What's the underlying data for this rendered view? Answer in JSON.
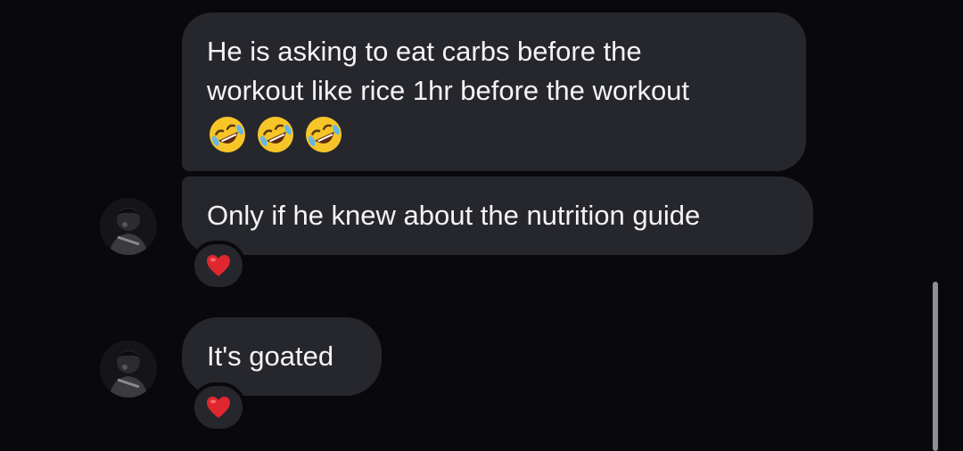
{
  "messages": [
    {
      "text_line1": "He is asking to eat carbs before the",
      "text_line2": "workout like rice 1hr before the workout",
      "emojis": [
        "rolling-on-the-floor-laughing",
        "rolling-on-the-floor-laughing",
        "rolling-on-the-floor-laughing"
      ]
    },
    {
      "text": "Only if he knew about the nutrition guide",
      "reaction": "red-heart"
    },
    {
      "text": "It's goated",
      "reaction": "red-heart"
    }
  ],
  "colors": {
    "background": "#09090c",
    "bubble": "#26272c",
    "text": "#f4f4f6",
    "heart": "#e0262e",
    "emoji_face": "#f7c528",
    "scrollbar": "#8e8e93"
  }
}
